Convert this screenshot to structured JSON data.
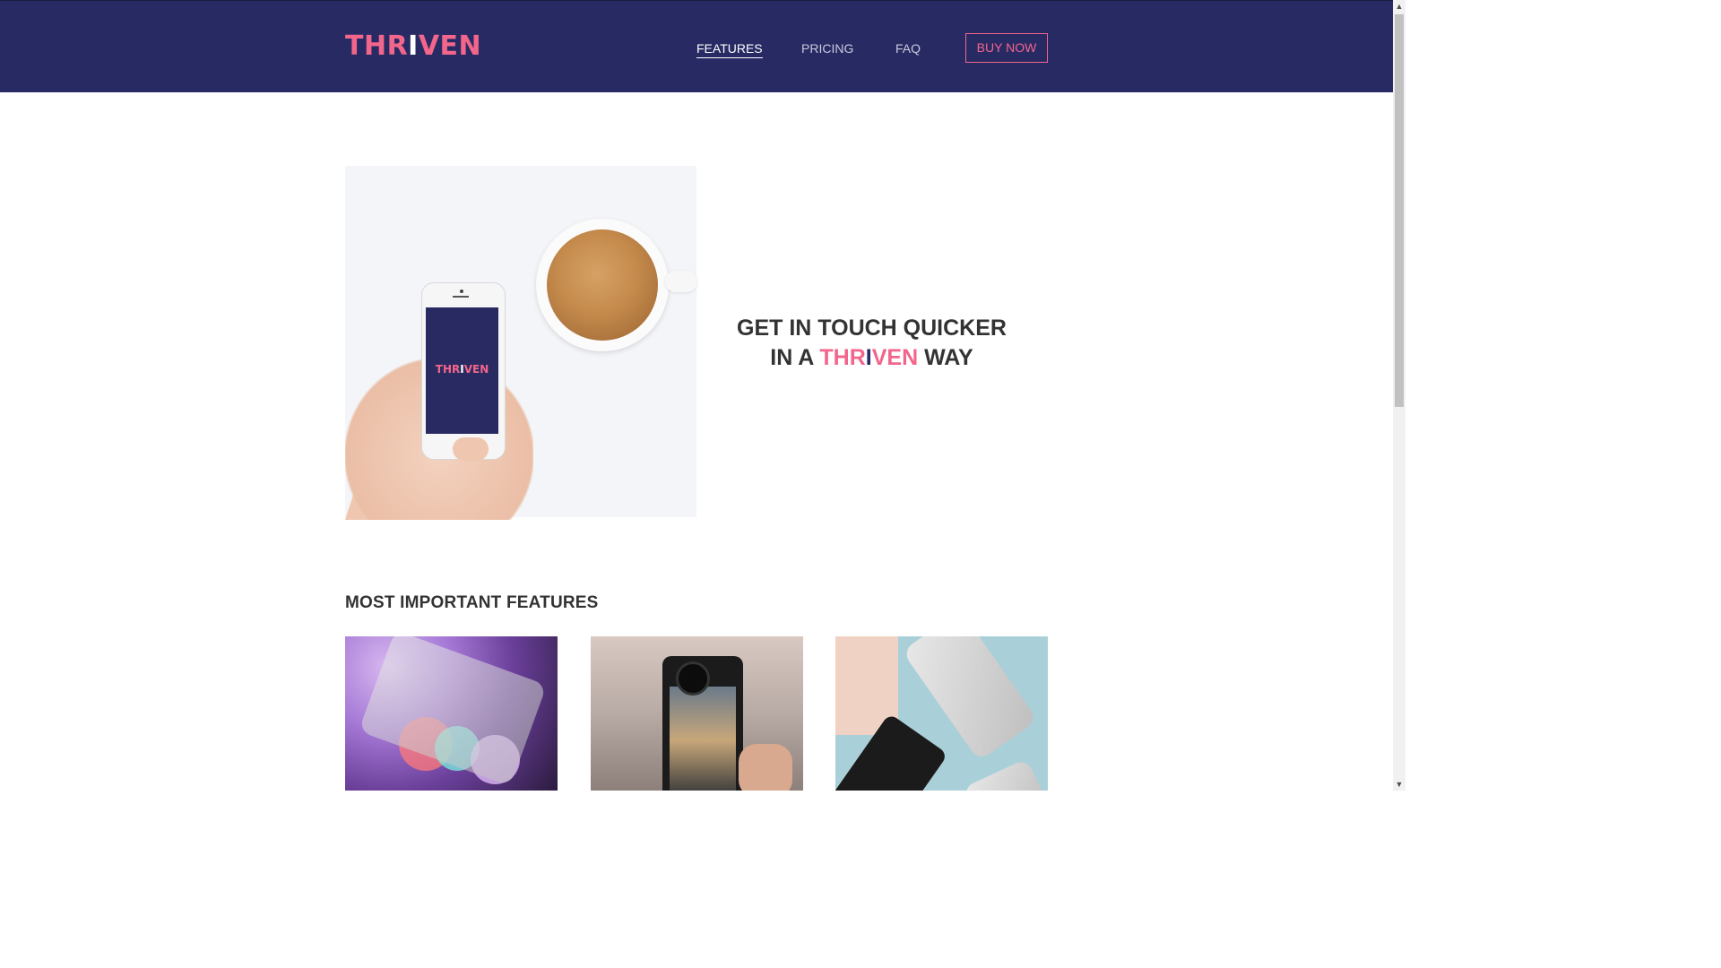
{
  "brand": {
    "logo_start": "THR",
    "logo_mid": "I",
    "logo_end": "VEN",
    "primary_color": "#282a64",
    "accent_color": "#f2668b"
  },
  "nav": {
    "items": [
      {
        "label": "FEATURES",
        "active": true
      },
      {
        "label": "PRICING",
        "active": false
      },
      {
        "label": "FAQ",
        "active": false
      }
    ],
    "cta_label": "BUY NOW"
  },
  "hero": {
    "line1": "GET IN TOUCH QUICKER",
    "line2_prefix": "IN A",
    "line2_brand_start": "THR",
    "line2_brand_mid": "I",
    "line2_brand_end": "VEN",
    "line2_suffix": "WAY",
    "image_icon": "phone-and-coffee-photo",
    "phone_screen_logo_start": "THR",
    "phone_screen_logo_mid": "I",
    "phone_screen_logo_end": "VEN"
  },
  "features": {
    "title": "MOST IMPORTANT FEATURES",
    "cards": [
      {
        "image_icon": "phone-bokeh-photo"
      },
      {
        "image_icon": "phone-camera-lens-photo"
      },
      {
        "image_icon": "phones-on-blue-photo"
      }
    ]
  },
  "scrollbar": {
    "up_icon": "arrow-up-icon",
    "down_icon": "arrow-down-icon"
  }
}
